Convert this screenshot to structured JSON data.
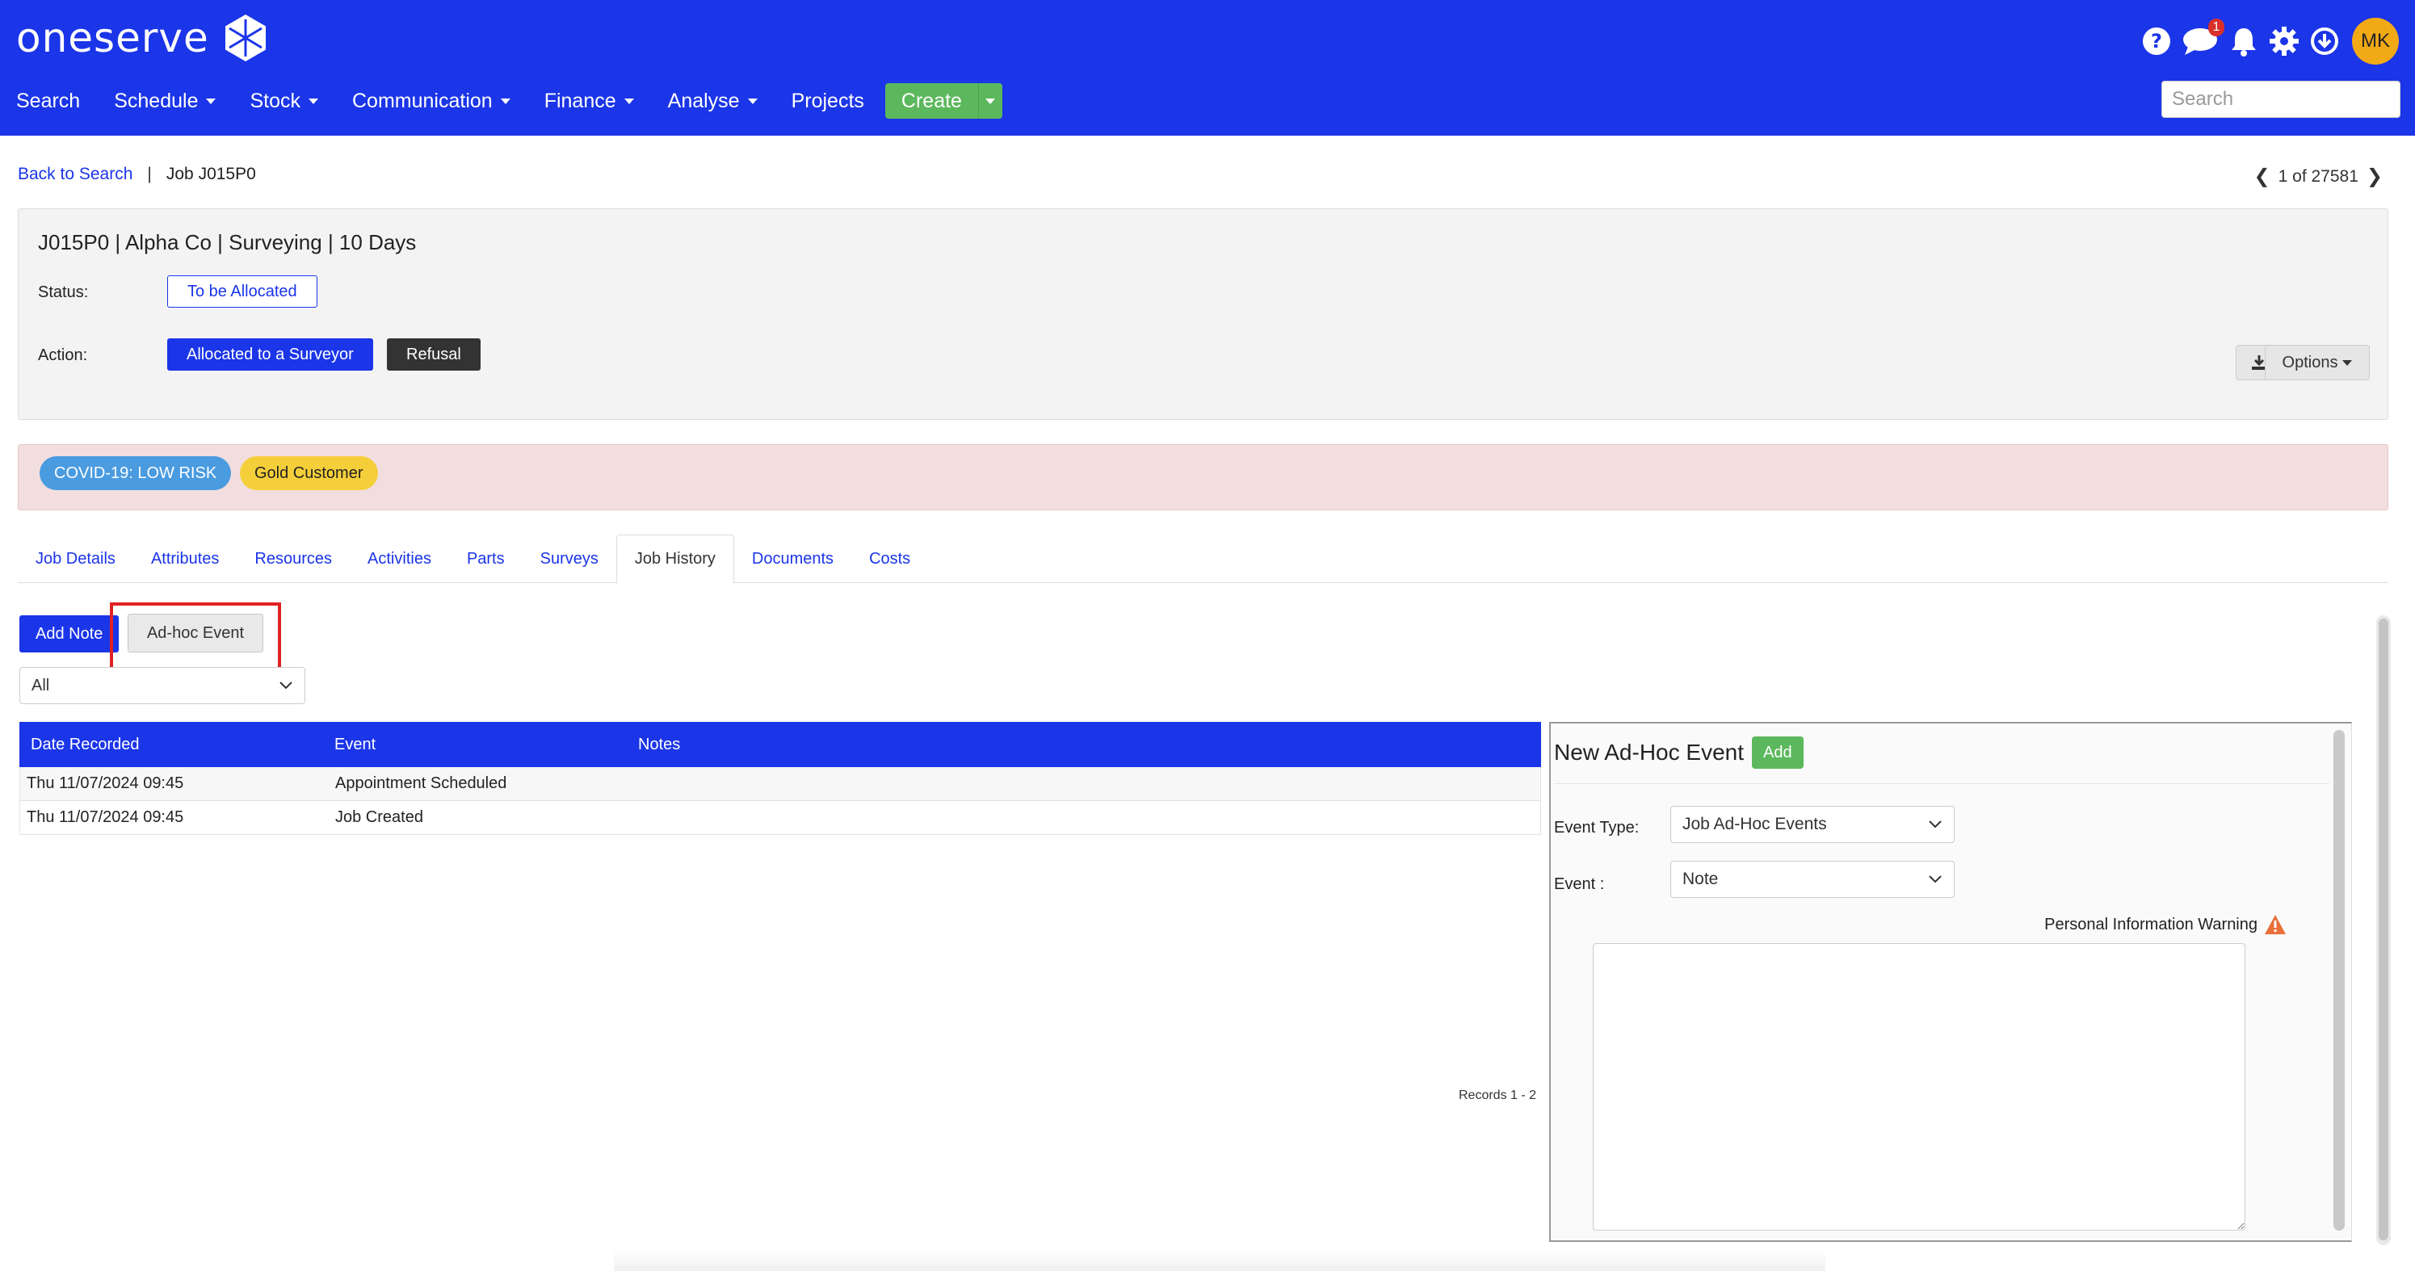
{
  "brand": {
    "name": "oneserve",
    "color": "#1b35e8"
  },
  "nav": {
    "items": [
      {
        "label": "Search",
        "dropdown": false
      },
      {
        "label": "Schedule",
        "dropdown": true
      },
      {
        "label": "Stock",
        "dropdown": true
      },
      {
        "label": "Communication",
        "dropdown": true
      },
      {
        "label": "Finance",
        "dropdown": true
      },
      {
        "label": "Analyse",
        "dropdown": true
      },
      {
        "label": "Projects",
        "dropdown": false
      }
    ],
    "create_label": "Create",
    "search_placeholder": "Search",
    "icons": [
      "help-icon",
      "chat-icon",
      "bell-icon",
      "gear-icon",
      "download-circle-icon"
    ],
    "chat_badge": "1",
    "avatar_initials": "MK"
  },
  "breadcrumb": {
    "back_label": "Back to Search",
    "separator": "|",
    "current": "Job J015P0"
  },
  "pager": {
    "text": "1 of 27581"
  },
  "job": {
    "title": "J015P0 | Alpha Co | Surveying | 10 Days",
    "status_label": "Status:",
    "status_value": "To be Allocated",
    "action_label": "Action:",
    "actions": [
      "Allocated to a Surveyor",
      "Refusal"
    ],
    "options_label": "Options"
  },
  "tags": {
    "covid": "COVID-19: LOW RISK",
    "customer": "Gold Customer"
  },
  "tabs": [
    {
      "label": "Job Details",
      "active": false
    },
    {
      "label": "Attributes",
      "active": false
    },
    {
      "label": "Resources",
      "active": false
    },
    {
      "label": "Activities",
      "active": false
    },
    {
      "label": "Parts",
      "active": false
    },
    {
      "label": "Surveys",
      "active": false
    },
    {
      "label": "Job History",
      "active": true
    },
    {
      "label": "Documents",
      "active": false
    },
    {
      "label": "Costs",
      "active": false
    }
  ],
  "history": {
    "add_note_label": "Add Note",
    "adhoc_label": "Ad-hoc Event",
    "filter_value": "All",
    "columns": [
      "Date Recorded",
      "Event",
      "Notes"
    ],
    "rows": [
      [
        "Thu 11/07/2024 09:45",
        "Appointment Scheduled",
        ""
      ],
      [
        "Thu 11/07/2024 09:45",
        "Job Created",
        ""
      ]
    ],
    "records_text": "Records 1 - 2"
  },
  "adhoc_panel": {
    "title": "New Ad-Hoc Event",
    "add_label": "Add",
    "event_type_label": "Event Type:",
    "event_type_value": "Job Ad-Hoc Events",
    "event_label": "Event :",
    "event_value": "Note",
    "warning_text": "Personal Information Warning",
    "notes_value": ""
  }
}
